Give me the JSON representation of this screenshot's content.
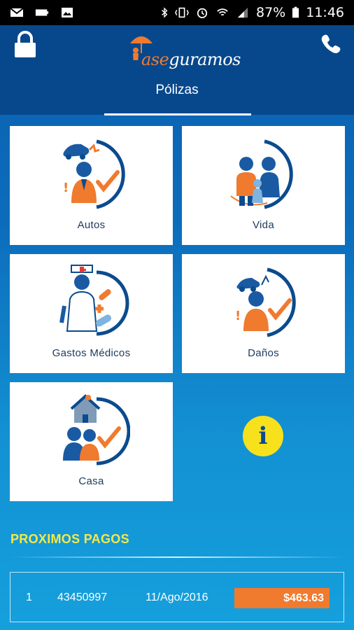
{
  "status_bar": {
    "battery_percent": "87%",
    "time": "11:46"
  },
  "header": {
    "logo_text_prefix": "ase",
    "logo_text_suffix": "guramos",
    "page_title": "Pólizas"
  },
  "tiles": [
    {
      "label": "Autos",
      "icon": "car-accident-icon"
    },
    {
      "label": "Vida",
      "icon": "family-icon"
    },
    {
      "label": "Gastos Médicos",
      "icon": "nurse-icon"
    },
    {
      "label": "Daños",
      "icon": "damage-icon"
    },
    {
      "label": "Casa",
      "icon": "house-icon"
    }
  ],
  "info_button": {
    "glyph": "i"
  },
  "payments": {
    "title": "PROXIMOS PAGOS",
    "rows": [
      {
        "index": "1",
        "policy": "43450997",
        "date": "11/Ago/2016",
        "amount": "$463.63"
      }
    ]
  },
  "colors": {
    "header_bg": "#07488c",
    "accent_orange": "#f07a2e",
    "accent_yellow": "#f6e845",
    "icon_blue": "#0b4b8e"
  }
}
